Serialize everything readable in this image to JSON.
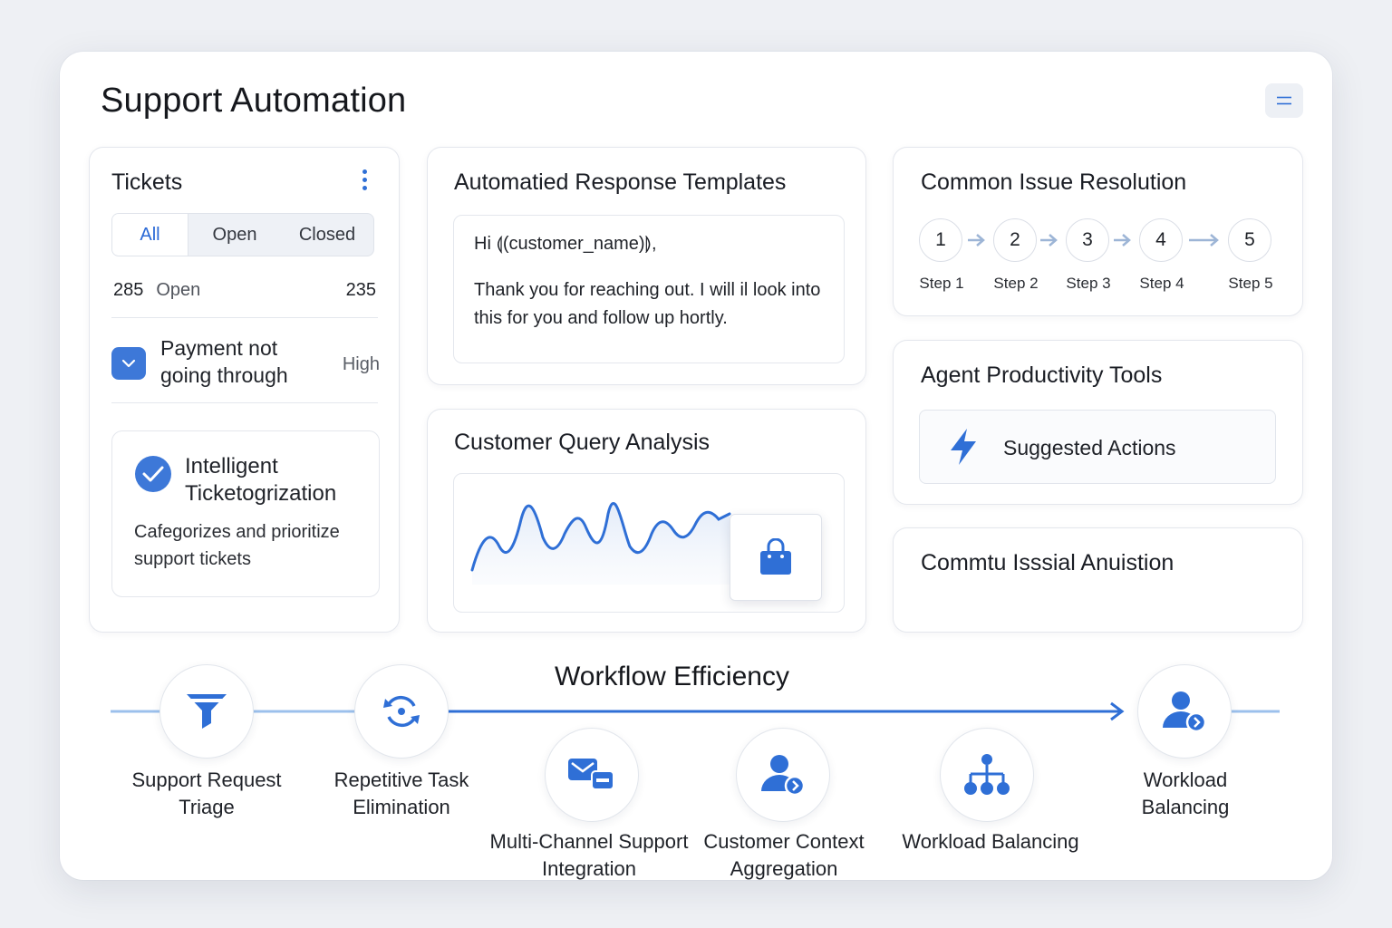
{
  "page": {
    "title": "Support Automation"
  },
  "tickets": {
    "title": "Tickets",
    "tabs": [
      "All",
      "Open",
      "Closed"
    ],
    "count_left": "285",
    "count_label": "Open",
    "count_right": "235",
    "item": {
      "text": "Payment not going through",
      "priority": "High"
    },
    "feature": {
      "title": "Intelligent Ticketogrization",
      "description": "Cafegorizes and prioritize support tickets"
    }
  },
  "templates": {
    "title": "Automatied Response Templates",
    "greeting": "Hi ⟬(customer_name)⟭,",
    "body": "Thank you for reaching out. I will il look into this for you and follow up hortly."
  },
  "query": {
    "title": "Customer Query Analysis"
  },
  "resolution": {
    "title": "Common Issue Resolution",
    "steps": [
      {
        "num": "1",
        "label": "Step 1"
      },
      {
        "num": "2",
        "label": "Step 2"
      },
      {
        "num": "3",
        "label": "Step 3"
      },
      {
        "num": "4",
        "label": "Step 4"
      },
      {
        "num": "5",
        "label": "Step 5"
      }
    ]
  },
  "productivity": {
    "title": "Agent Productivity Tools",
    "action_label": "Suggested Actions"
  },
  "unknown_card": {
    "title": "Commtu Isssial Anuistion"
  },
  "workflow": {
    "title": "Workflow Efficiency",
    "nodes": [
      {
        "label": "Support Request Triage",
        "icon": "funnel-icon"
      },
      {
        "label": "Repetitive Task Elimination",
        "icon": "refresh-icon"
      },
      {
        "label": "Multi-Channel Support Integration",
        "icon": "message-icon"
      },
      {
        "label": "Customer Context Aggregation",
        "icon": "user-arrow-icon"
      },
      {
        "label": "Workload Balancing",
        "icon": "hierarchy-icon"
      },
      {
        "label": "Workload Balancing",
        "icon": "user-arrow-icon"
      }
    ]
  },
  "colors": {
    "accent": "#2f6fd6",
    "accent_light": "#8fb4ea",
    "text": "#1a1d24"
  }
}
